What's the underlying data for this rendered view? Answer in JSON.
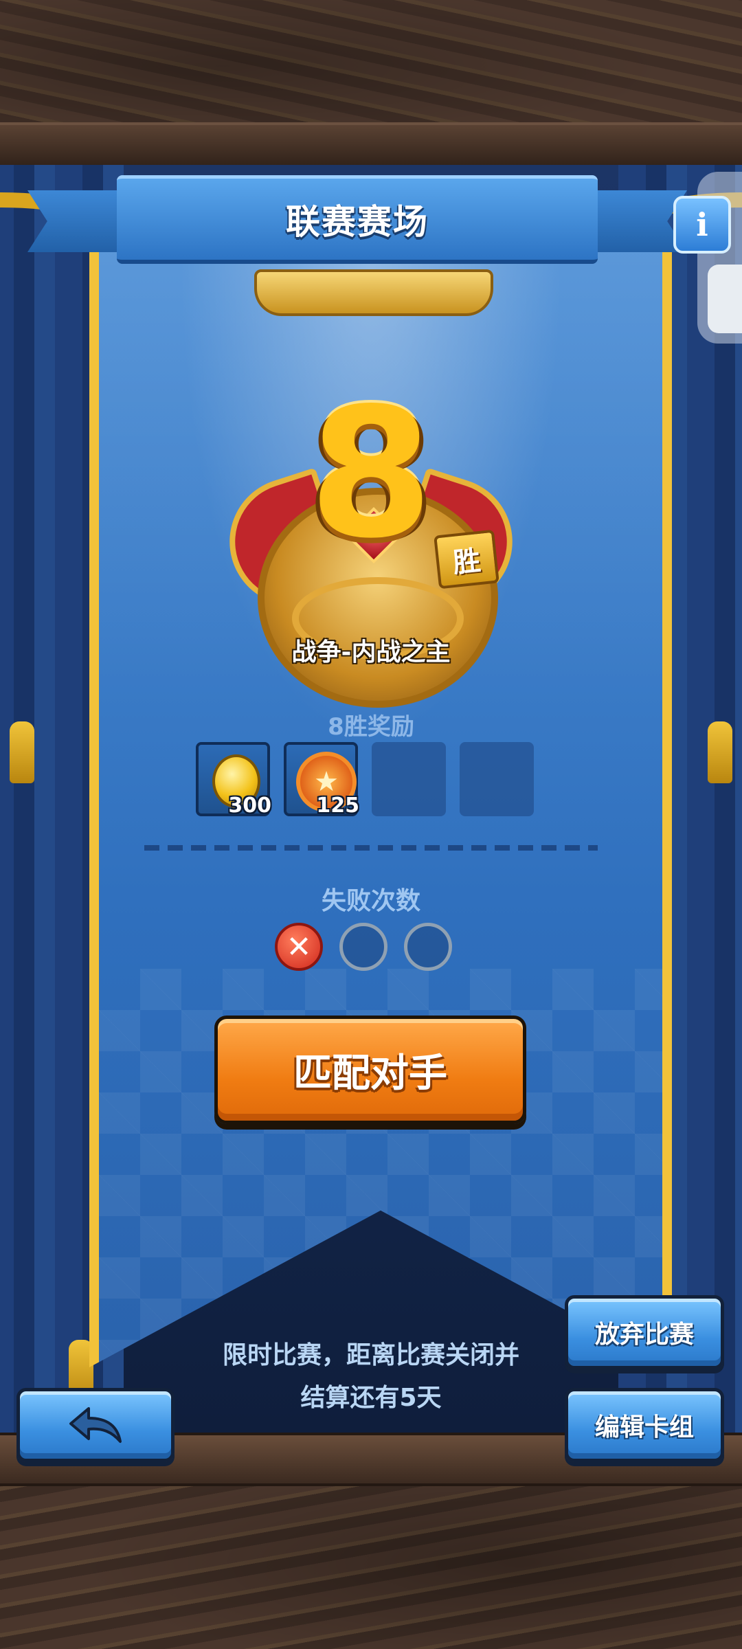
{
  "header": {
    "title": "联赛赛场"
  },
  "medal": {
    "wins": "8",
    "win_suffix": "胜",
    "title": "战争-内战之主"
  },
  "rewards": {
    "title": "8胜奖励",
    "items": [
      {
        "icon": "gold-coin-icon",
        "count": "300"
      },
      {
        "icon": "star-medal-icon",
        "count": "125"
      },
      {
        "icon": "",
        "count": ""
      },
      {
        "icon": "",
        "count": ""
      }
    ]
  },
  "failures": {
    "title": "失败次数",
    "used": 1,
    "max": 3
  },
  "buttons": {
    "match": "匹配对手",
    "quit": "放弃比赛",
    "edit_deck": "编辑卡组",
    "info": "i"
  },
  "footer": {
    "line1": "限时比赛，距离比赛关闭并",
    "line2": "结算还有5天"
  },
  "colors": {
    "accent_orange": "#f07c12",
    "gold": "#ffc21a",
    "banner_blue": "#2f6fbd"
  }
}
